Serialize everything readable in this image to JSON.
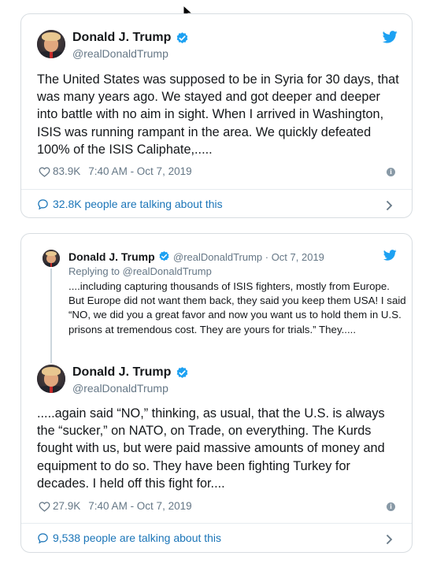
{
  "colors": {
    "blue": "#1da1f2",
    "link": "#1b75b8",
    "grey": "#657786",
    "border": "#d8dde1"
  },
  "tweet1": {
    "name": "Donald J. Trump",
    "handle": "@realDonaldTrump",
    "text": "The United States was supposed to be in Syria for 30 days, that was many years ago. We stayed and got deeper and deeper into battle with no aim in sight. When I arrived in Washington, ISIS was running rampant in the area. We quickly defeated 100% of the ISIS Caliphate,.....",
    "likes": "83.9K",
    "timestamp": "7:40 AM - Oct 7, 2019",
    "talking": "32.8K people are talking about this"
  },
  "tweet2": {
    "parent": {
      "name": "Donald J. Trump",
      "handle_date": "@realDonaldTrump · Oct 7, 2019",
      "replying_to": "Replying to @realDonaldTrump",
      "text": "....including capturing thousands of ISIS fighters, mostly from Europe. But Europe did not want them back, they said you keep them USA! I said “NO, we did you a great favor and now you want us to hold them in U.S. prisons at tremendous cost. They are yours for trials.” They....."
    },
    "name": "Donald J. Trump",
    "handle": "@realDonaldTrump",
    "text": ".....again said “NO,” thinking, as usual, that the U.S. is always the “sucker,” on NATO, on Trade, on everything. The Kurds fought with us, but were paid massive amounts of money and equipment to do so. They have been fighting Turkey for decades. I held off this fight for....",
    "likes": "27.9K",
    "timestamp": "7:40 AM - Oct 7, 2019",
    "talking": "9,538 people are talking about this"
  },
  "icons": {
    "info": "i"
  }
}
